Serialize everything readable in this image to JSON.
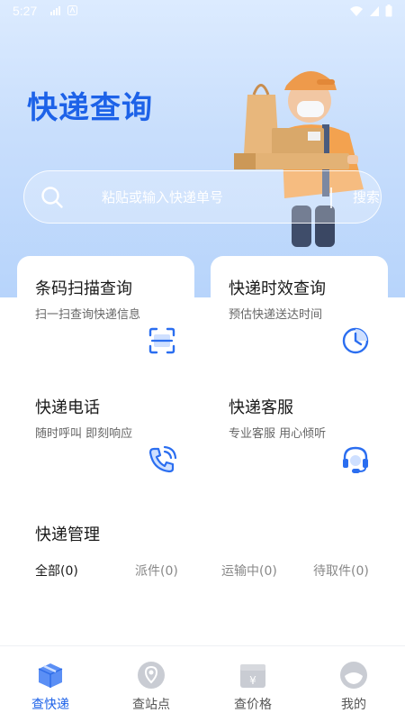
{
  "status_bar": {
    "time": "5:27"
  },
  "hero": {
    "title": "快递查询"
  },
  "search": {
    "placeholder": "粘贴或输入快递单号",
    "button_label": "搜索"
  },
  "cards": [
    {
      "title": "条码扫描查询",
      "subtitle": "扫一扫查询快递信息",
      "icon": "scan-icon"
    },
    {
      "title": "快递时效查询",
      "subtitle": "预估快递送达时间",
      "icon": "clock-icon"
    },
    {
      "title": "快递电话",
      "subtitle": "随时呼叫 即刻响应",
      "icon": "phone-icon"
    },
    {
      "title": "快递客服",
      "subtitle": "专业客服 用心倾听",
      "icon": "headset-icon"
    }
  ],
  "management": {
    "title": "快递管理",
    "tabs": [
      {
        "label": "全部(0)"
      },
      {
        "label": "派件(0)"
      },
      {
        "label": "运输中(0)"
      },
      {
        "label": "待取件(0)"
      }
    ]
  },
  "tabbar": {
    "items": [
      {
        "label": "查快递",
        "icon": "package-icon",
        "active": true
      },
      {
        "label": "查站点",
        "icon": "location-pin-icon",
        "active": false
      },
      {
        "label": "查价格",
        "icon": "price-box-icon",
        "active": false
      },
      {
        "label": "我的",
        "icon": "profile-icon",
        "active": false
      }
    ]
  },
  "colors": {
    "accent": "#1d62e8",
    "hero_top": "#dcebff",
    "hero_bottom": "#b7d4fb"
  }
}
